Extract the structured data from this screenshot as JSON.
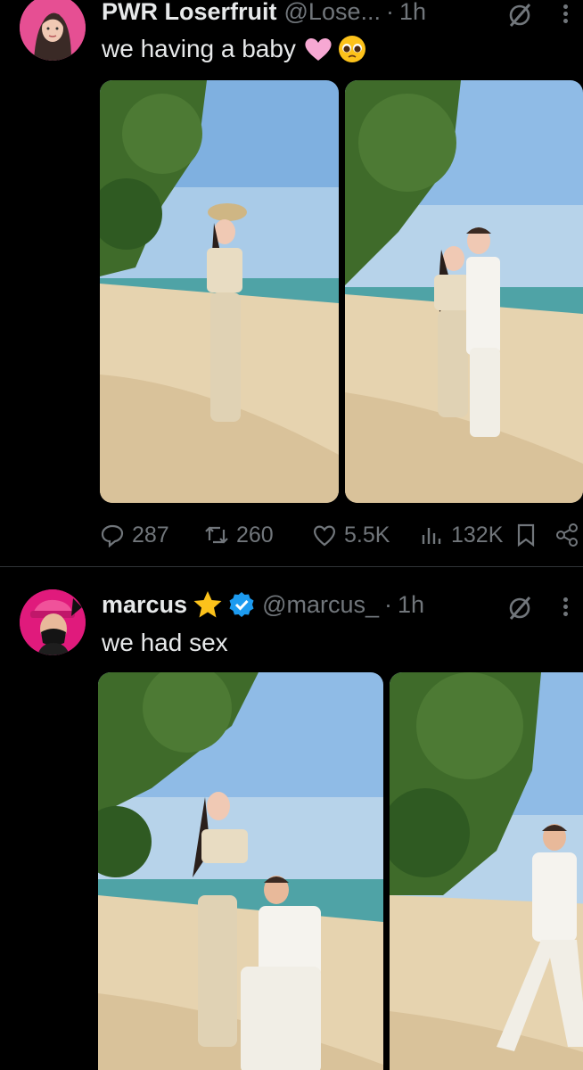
{
  "tweets": [
    {
      "name": "PWR Loserfruit",
      "handle": "@Lose...",
      "separator": "·",
      "time": "1h",
      "text": "we having a baby",
      "emojis": [
        "pink-heart-emoji",
        "pleading-face-emoji"
      ],
      "stats": {
        "replies": "287",
        "reposts": "260",
        "likes": "5.5K",
        "views": "132K"
      }
    },
    {
      "name": "marcus",
      "handle": "@marcus_",
      "separator": "·",
      "time": "1h",
      "text": "we had sex",
      "badges": [
        "star-emoji",
        "verified-badge-icon"
      ]
    }
  ],
  "icons": [
    "reply-icon",
    "repost-icon",
    "like-icon",
    "views-icon",
    "bookmark-icon",
    "share-icon",
    "grok-icon",
    "more-icon"
  ],
  "colors": {
    "background": "#000000",
    "text": "#e7e9ea",
    "muted": "#71767b",
    "divider": "#2f3336",
    "verified": "#1d9bf0"
  }
}
